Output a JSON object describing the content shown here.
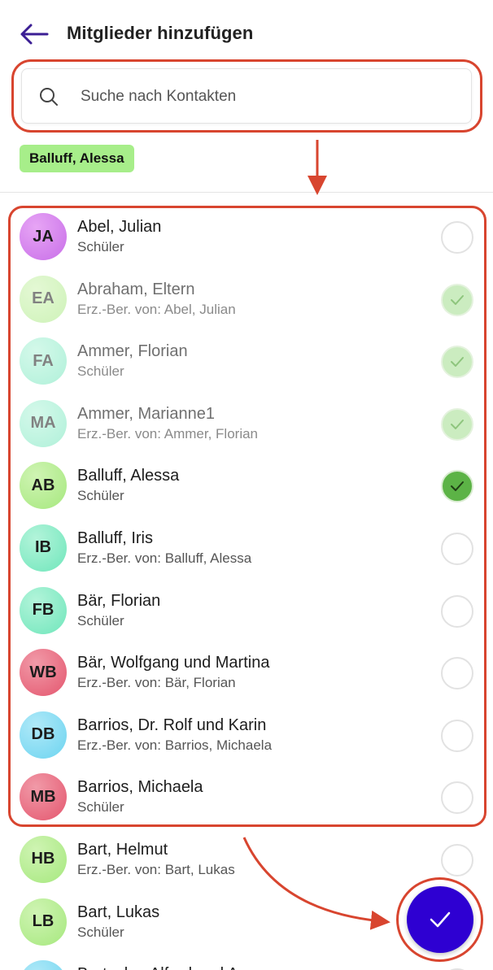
{
  "header": {
    "title": "Mitglieder hinzufügen",
    "back_icon": "arrow-left-icon"
  },
  "search": {
    "placeholder": "Suche nach Kontakten",
    "value": ""
  },
  "selected_chips": [
    {
      "label": "Balluff, Alessa"
    }
  ],
  "colors": {
    "accent": "#2e00d2",
    "annotation": "#d8452f",
    "chip": "#a7ee8a",
    "check_selected": "#5cb346"
  },
  "contacts": [
    {
      "initials": "JA",
      "name": "Abel, Julian",
      "sub": "Schüler",
      "state": "unchecked",
      "color": "#c86ee8",
      "color2": "#e7a5f5"
    },
    {
      "initials": "EA",
      "name": "Abraham, Eltern",
      "sub": "Erz.-Ber. von: Abel, Julian",
      "state": "locked",
      "color": "#a6e87e",
      "color2": "#cff4b3"
    },
    {
      "initials": "FA",
      "name": "Ammer, Florian",
      "sub": "Schüler",
      "state": "locked",
      "color": "#6fe6bb",
      "color2": "#b3f4da"
    },
    {
      "initials": "MA",
      "name": "Ammer, Marianne1",
      "sub": "Erz.-Ber. von: Ammer, Florian",
      "state": "locked",
      "color": "#6fe6bb",
      "color2": "#b3f4da"
    },
    {
      "initials": "AB",
      "name": "Balluff, Alessa",
      "sub": "Schüler",
      "state": "selected",
      "color": "#a6e87e",
      "color2": "#cff4b3"
    },
    {
      "initials": "IB",
      "name": "Balluff, Iris",
      "sub": "Erz.-Ber. von: Balluff, Alessa",
      "state": "unchecked",
      "color": "#6fe6bb",
      "color2": "#b3f4da"
    },
    {
      "initials": "FB",
      "name": "Bär, Florian",
      "sub": "Schüler",
      "state": "unchecked",
      "color": "#6fe6bb",
      "color2": "#b3f4da"
    },
    {
      "initials": "WB",
      "name": "Bär, Wolfgang und Martina",
      "sub": "Erz.-Ber. von: Bär, Florian",
      "state": "unchecked",
      "color": "#e4566e",
      "color2": "#f19aa8"
    },
    {
      "initials": "DB",
      "name": "Barrios, Dr. Rolf und Karin",
      "sub": "Erz.-Ber. von: Barrios, Michaela",
      "state": "unchecked",
      "color": "#6cd4f0",
      "color2": "#b0e9f8"
    },
    {
      "initials": "MB",
      "name": "Barrios, Michaela",
      "sub": "Schüler",
      "state": "unchecked",
      "color": "#e4566e",
      "color2": "#f19aa8"
    },
    {
      "initials": "HB",
      "name": "Bart, Helmut",
      "sub": "Erz.-Ber. von: Bart, Lukas",
      "state": "unchecked",
      "color": "#a6e87e",
      "color2": "#cff4b3"
    },
    {
      "initials": "LB",
      "name": "Bart, Lukas",
      "sub": "Schüler",
      "state": "unchecked",
      "color": "#a6e87e",
      "color2": "#cff4b3"
    },
    {
      "initials": "",
      "name": "Bartaska, Alfred und Anna",
      "sub": "",
      "state": "unchecked",
      "color": "#6cd4f0",
      "color2": "#b0e9f8"
    }
  ],
  "fab": {
    "icon": "check-icon"
  }
}
